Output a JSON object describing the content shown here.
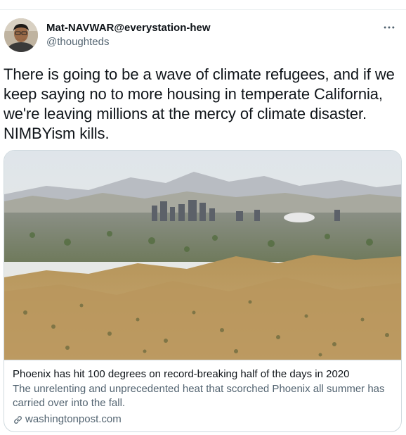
{
  "author": {
    "display_name": "Mat-NAVWAR@everystation-hew",
    "handle": "@thoughteds",
    "avatar_icon": "profile-photo"
  },
  "tweet": {
    "text": "There is going to be a wave of climate refugees, and if we keep saying no to more housing in temperate California, we're leaving millions at the mercy of climate disaster. NIMBYism kills."
  },
  "more_icon": "more-horizontal-icon",
  "card": {
    "image_desc": "desert-city-landscape",
    "title": "Phoenix has hit 100 degrees on record-breaking half of the days in 2020",
    "description": "The unrelenting and unprecedented heat that scorched Phoenix all summer has carried over into the fall.",
    "domain": "washingtonpost.com",
    "domain_icon": "link-icon"
  },
  "colors": {
    "text_primary": "#0f1419",
    "text_secondary": "#536471",
    "border": "#cfd9de"
  }
}
